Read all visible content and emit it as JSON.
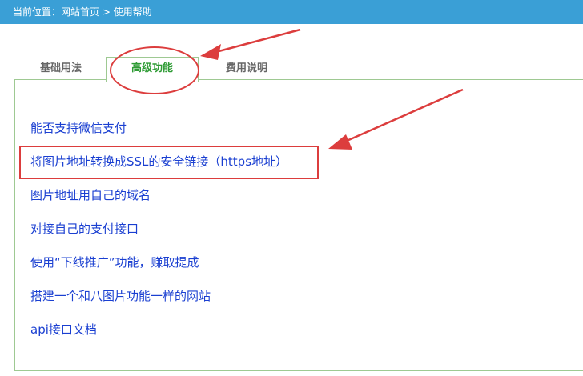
{
  "breadcrumb": {
    "text": "当前位置：网站首页 > 使用帮助"
  },
  "tabs": [
    {
      "label": "基础用法"
    },
    {
      "label": "高级功能"
    },
    {
      "label": "费用说明"
    }
  ],
  "help_links": [
    {
      "label": "能否支持微信支付"
    },
    {
      "label": "将图片地址转换成SSL的安全链接（https地址）"
    },
    {
      "label": "图片地址用自己的域名"
    },
    {
      "label": "对接自己的支付接口"
    },
    {
      "label": "使用“下线推广”功能，赚取提成"
    },
    {
      "label": "搭建一个和八图片功能一样的网站"
    },
    {
      "label": "api接口文档"
    }
  ],
  "colors": {
    "header_bar": "#3a9fd6",
    "active_tab": "#2e9b34",
    "link": "#1a3fd1",
    "annotation": "#dc3d3d",
    "panel_border": "#9ec992"
  }
}
